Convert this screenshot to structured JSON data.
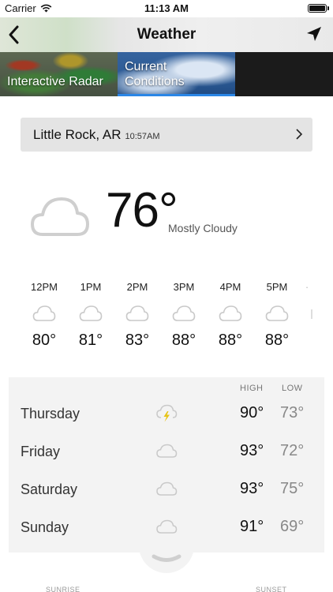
{
  "status_bar": {
    "carrier": "Carrier",
    "time": "11:13 AM"
  },
  "nav": {
    "title": "Weather"
  },
  "tabs": [
    {
      "label_line1": "Interactive Radar",
      "label_line2": ""
    },
    {
      "label_line1": "Current",
      "label_line2": "Conditions"
    }
  ],
  "location": {
    "city": "Little Rock, AR",
    "time": "10:57AM"
  },
  "current": {
    "temp": "76°",
    "condition": "Mostly Cloudy",
    "icon": "cloud-icon"
  },
  "hourly": [
    {
      "time": "12PM",
      "temp": "80°",
      "icon": "cloud-icon"
    },
    {
      "time": "1PM",
      "temp": "81°",
      "icon": "cloud-icon"
    },
    {
      "time": "2PM",
      "temp": "83°",
      "icon": "cloud-icon"
    },
    {
      "time": "3PM",
      "temp": "88°",
      "icon": "cloud-icon"
    },
    {
      "time": "4PM",
      "temp": "88°",
      "icon": "cloud-icon"
    },
    {
      "time": "5PM",
      "temp": "88°",
      "icon": "cloud-icon"
    }
  ],
  "daily": {
    "header_high": "HIGH",
    "header_low": "LOW",
    "days": [
      {
        "name": "Thursday",
        "high": "90°",
        "low": "73°",
        "icon": "thunderstorm-icon"
      },
      {
        "name": "Friday",
        "high": "93°",
        "low": "72°",
        "icon": "cloud-icon"
      },
      {
        "name": "Saturday",
        "high": "93°",
        "low": "75°",
        "icon": "cloud-icon"
      },
      {
        "name": "Sunday",
        "high": "91°",
        "low": "69°",
        "icon": "cloud-icon"
      }
    ]
  },
  "sun": {
    "sunrise_label": "SUNRISE",
    "sunset_label": "SUNSET"
  },
  "colors": {
    "tab_active_underline": "#2a86e6",
    "thunder_bolt": "#e7c416",
    "cloud_stroke": "#cfcfcf"
  }
}
